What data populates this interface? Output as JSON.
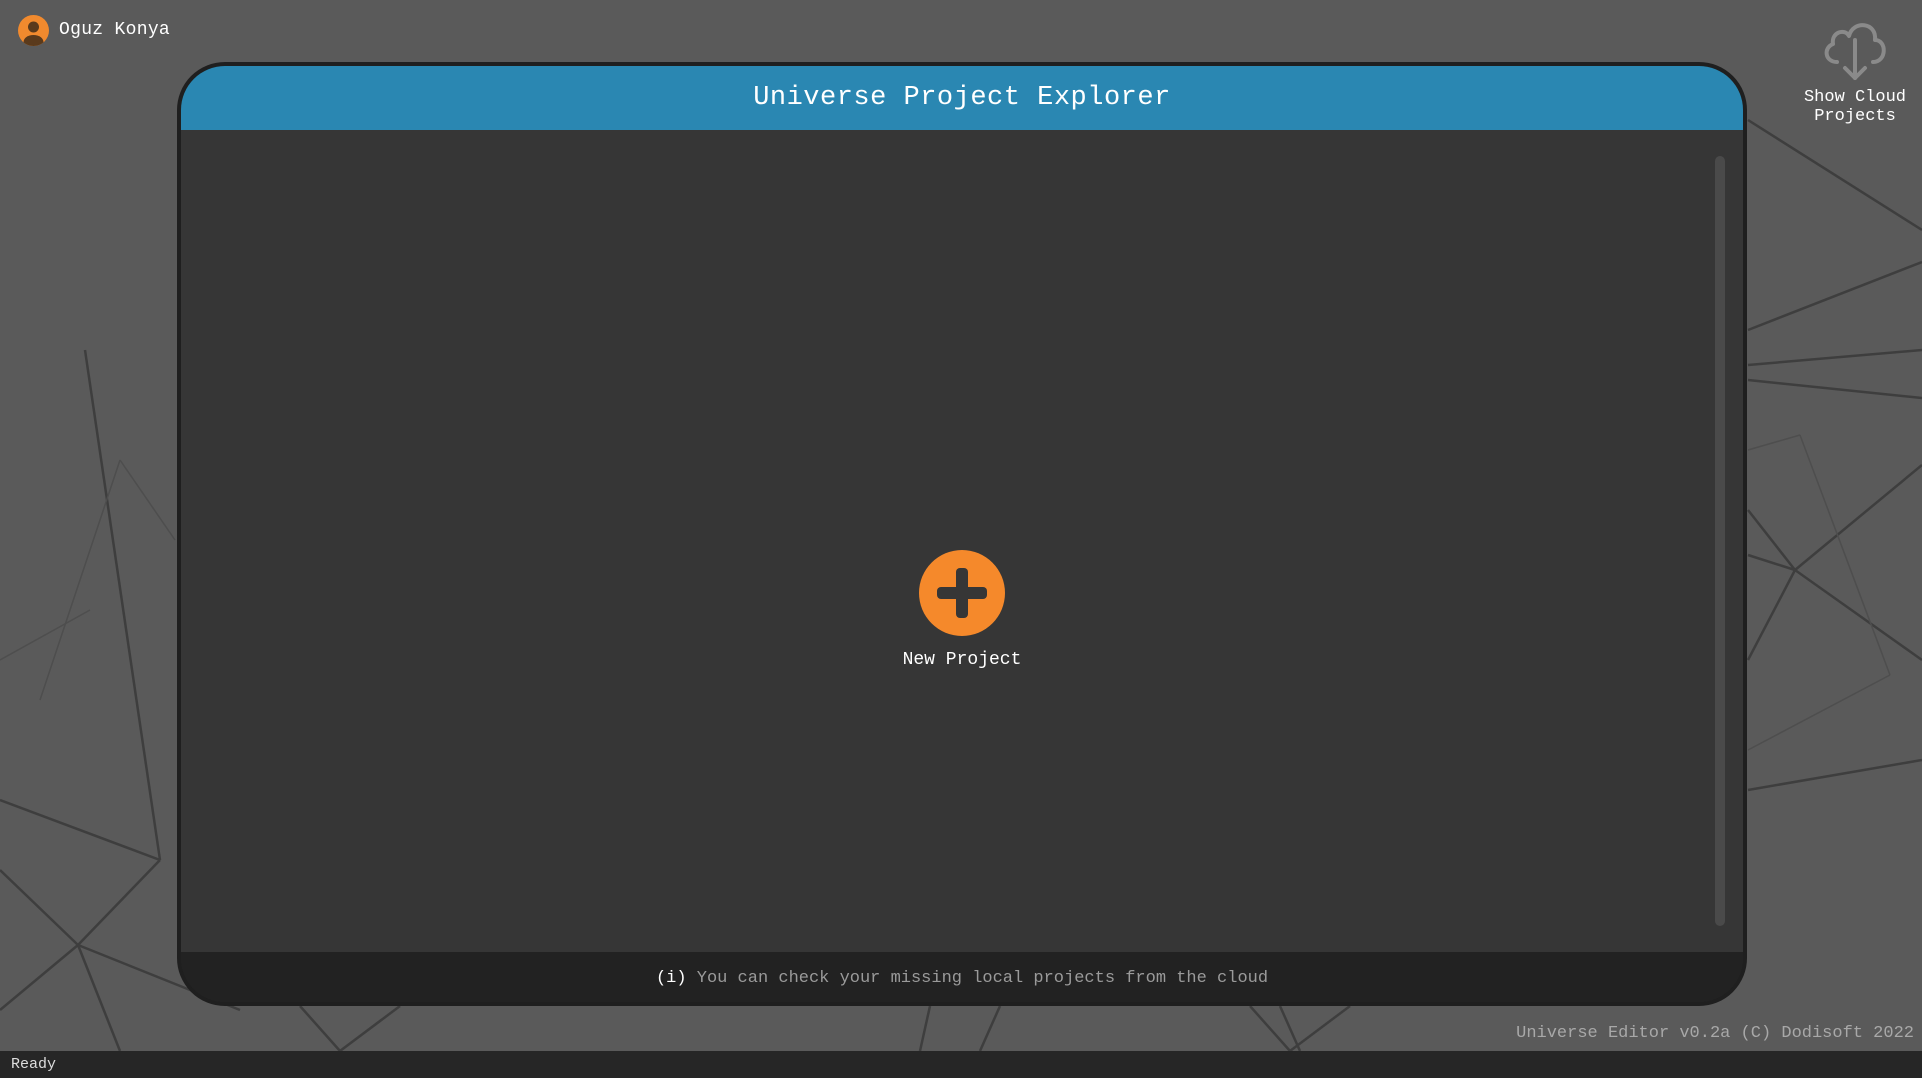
{
  "user": {
    "name": "Oguz Konya",
    "icon": "user-avatar-icon"
  },
  "cloud": {
    "label": "Show Cloud\nProjects",
    "icon": "cloud-download-icon"
  },
  "panel": {
    "title": "Universe Project Explorer",
    "new_project_label": "New Project",
    "new_project_icon": "plus-circle-icon",
    "footer_prefix": "(i)",
    "footer_text": "You can check your missing local projects from the cloud"
  },
  "version_text": "Universe Editor v0.2a (C) Dodisoft 2022",
  "status": "Ready",
  "colors": {
    "accent_blue": "#2a87b2",
    "accent_orange": "#f5892b",
    "background": "#5a5a5a",
    "panel": "#363636"
  }
}
